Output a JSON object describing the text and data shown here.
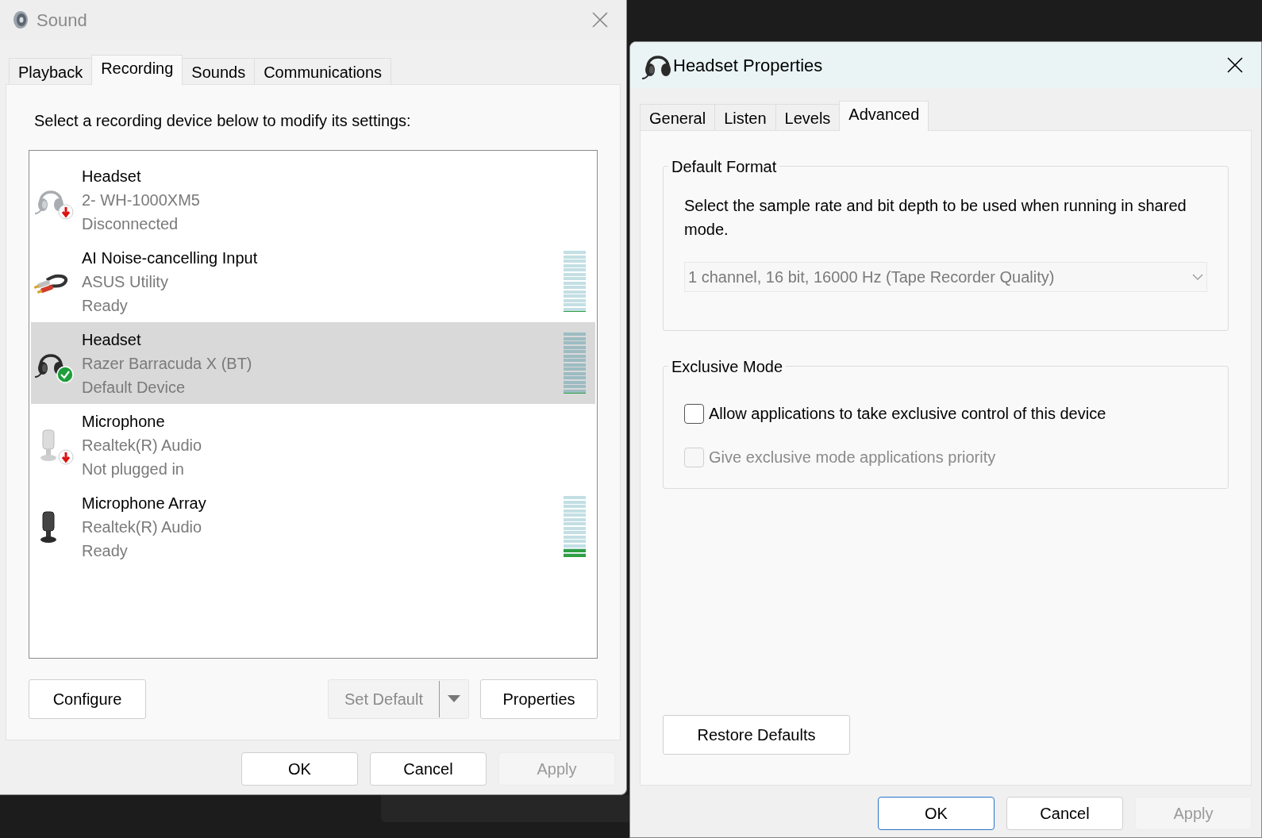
{
  "sound_window": {
    "title": "Sound",
    "tabs": [
      {
        "label": "Playback",
        "selected": false
      },
      {
        "label": "Recording",
        "selected": true
      },
      {
        "label": "Sounds",
        "selected": false
      },
      {
        "label": "Communications",
        "selected": false
      }
    ],
    "instruction": "Select a recording device below to modify its settings:",
    "devices": [
      {
        "kind": "headset",
        "disconnected": true,
        "default": false,
        "name": "Headset",
        "detail": "2- WH-1000XM5",
        "status": "Disconnected",
        "selected": false
      },
      {
        "kind": "cable",
        "disconnected": false,
        "default": false,
        "name": "AI Noise-cancelling Input",
        "detail": "ASUS Utility",
        "status": "Ready",
        "selected": false,
        "level": 0
      },
      {
        "kind": "headset",
        "disconnected": false,
        "default": true,
        "name": "Headset",
        "detail": "Razer Barracuda X (BT)",
        "status": "Default Device",
        "selected": true,
        "level": 0
      },
      {
        "kind": "microphone",
        "disconnected": true,
        "default": false,
        "name": "Microphone",
        "detail": "Realtek(R) Audio",
        "status": "Not plugged in",
        "selected": false
      },
      {
        "kind": "mic-array",
        "disconnected": false,
        "default": false,
        "name": "Microphone Array",
        "detail": "Realtek(R) Audio",
        "status": "Ready",
        "selected": false,
        "level": 0.14
      }
    ],
    "configure_button": "Configure",
    "set_default_button": {
      "label": "Set Default",
      "disabled": true
    },
    "properties_button": "Properties",
    "footer_buttons": [
      {
        "label": "OK",
        "disabled": false,
        "default": false
      },
      {
        "label": "Cancel",
        "disabled": false,
        "default": false
      },
      {
        "label": "Apply",
        "disabled": true,
        "default": false
      }
    ]
  },
  "properties_window": {
    "title": "Headset Properties",
    "tabs": [
      {
        "label": "General",
        "selected": false
      },
      {
        "label": "Listen",
        "selected": false
      },
      {
        "label": "Levels",
        "selected": false
      },
      {
        "label": "Advanced",
        "selected": true
      }
    ],
    "default_format": {
      "title": "Default Format",
      "description": "Select the sample rate and bit depth to be used when running in shared mode.",
      "format_select": {
        "value": "1 channel, 16 bit, 16000 Hz (Tape Recorder Quality)",
        "disabled": true
      }
    },
    "exclusive_mode": {
      "title": "Exclusive Mode",
      "options": [
        {
          "label": "Allow applications to take exclusive control of this device",
          "checked": false,
          "disabled": false
        },
        {
          "label": "Give exclusive mode applications priority",
          "checked": false,
          "disabled": true
        }
      ]
    },
    "restore_button": "Restore Defaults",
    "footer_buttons": [
      {
        "label": "OK",
        "disabled": false,
        "default": true
      },
      {
        "label": "Cancel",
        "disabled": false,
        "default": false
      },
      {
        "label": "Apply",
        "disabled": true,
        "default": false
      }
    ]
  }
}
